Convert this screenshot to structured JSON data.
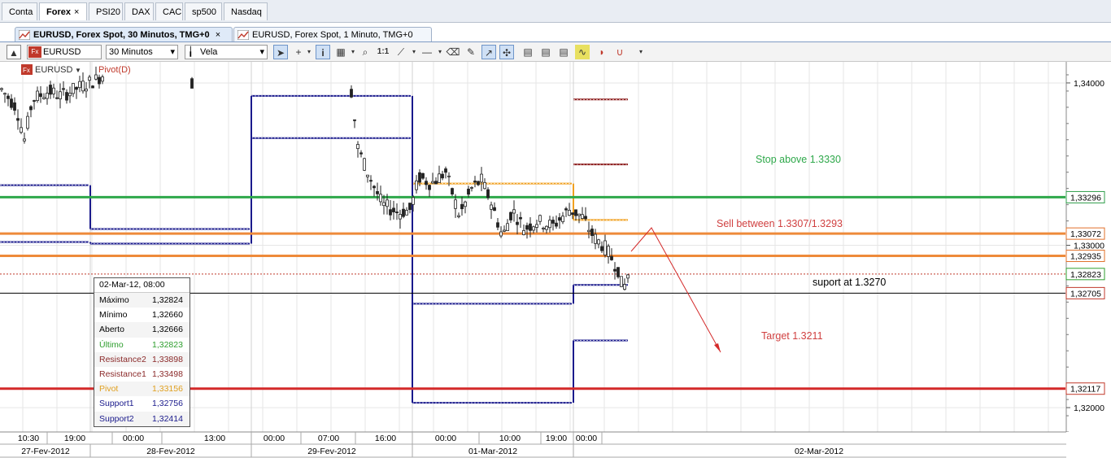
{
  "tabs": [
    {
      "label": "Conta",
      "active": false
    },
    {
      "label": "Forex",
      "active": true,
      "close": "×"
    },
    {
      "label": "PSI20",
      "active": false
    },
    {
      "label": "DAX",
      "active": false
    },
    {
      "label": "CAC",
      "active": false
    },
    {
      "label": "sp500",
      "active": false
    },
    {
      "label": "Nasdaq",
      "active": false
    }
  ],
  "subtabs": [
    {
      "label": "EURUSD, Forex Spot, 30 Minutos, TMG+0",
      "active": true,
      "close": "×"
    },
    {
      "label": "EURUSD, Forex Spot, 1 Minuto, TMG+0",
      "active": false
    }
  ],
  "toolbar": {
    "symbol": "EURUSD",
    "interval": "30 Minutos",
    "chart_type": "Vela",
    "zoom_label": "1:1"
  },
  "overlay": {
    "symbol": "EURUSD",
    "indicator": "Pivot(D)"
  },
  "info_box": {
    "header": "02-Mar-12, 08:00",
    "rows": [
      {
        "label": "Máximo",
        "value": "1,32824",
        "color": "#000000"
      },
      {
        "label": "Mínimo",
        "value": "1,32660",
        "color": "#000000"
      },
      {
        "label": "Aberto",
        "value": "1,32666",
        "color": "#000000"
      },
      {
        "label": "Último",
        "value": "1,32823",
        "color": "#2e9e2e"
      },
      {
        "label": "Resistance2",
        "value": "1,33898",
        "color": "#8b2a2a"
      },
      {
        "label": "Resistance1",
        "value": "1,33498",
        "color": "#8b2a2a"
      },
      {
        "label": "Pivot",
        "value": "1,33156",
        "color": "#e0a020"
      },
      {
        "label": "Support1",
        "value": "1,32756",
        "color": "#1a1a8c"
      },
      {
        "label": "Support2",
        "value": "1,32414",
        "color": "#1a1a8c"
      }
    ]
  },
  "chart_data": {
    "type": "candlestick",
    "symbol": "EURUSD",
    "interval": "30 Minutos",
    "ylim": [
      1.3185,
      1.3413
    ],
    "y_ticks": [
      {
        "value": 1.34,
        "label": "1,34000"
      },
      {
        "value": 1.33,
        "label": "1,33000"
      },
      {
        "value": 1.32,
        "label": "1,32000"
      }
    ],
    "x_time_labels": [
      "10:30",
      "19:00",
      "00:00",
      "13:00",
      "00:00",
      "07:00",
      "16:00",
      "00:00",
      "10:00",
      "19:00",
      "00:00"
    ],
    "x_date_labels": [
      "27-Fev-2012",
      "28-Fev-2012",
      "29-Fev-2012",
      "01-Mar-2012",
      "02-Mar-2012"
    ],
    "price_labels": [
      {
        "value": 1.33296,
        "label": "1,33296",
        "color": "#2e9e4a"
      },
      {
        "value": 1.33072,
        "label": "1,33072",
        "color": "#e0712a"
      },
      {
        "value": 1.32935,
        "label": "1,32935",
        "color": "#e0712a"
      },
      {
        "value": 1.32823,
        "label": "1,32823",
        "color": "#2e9e2e"
      },
      {
        "value": 1.32705,
        "label": "1,32705",
        "color": "#c0392b"
      },
      {
        "value": 1.32117,
        "label": "1,32117",
        "color": "#c0392b"
      }
    ],
    "horizontal_lines": [
      {
        "name": "stop",
        "value": 1.33296,
        "color": "#2ea84a"
      },
      {
        "name": "sell-high",
        "value": 1.33072,
        "color": "#ee8a3a"
      },
      {
        "name": "sell-low",
        "value": 1.32935,
        "color": "#ee8a3a"
      },
      {
        "name": "support",
        "value": 1.32705,
        "color": "#000000"
      },
      {
        "name": "target",
        "value": 1.32117,
        "color": "#d42a2a"
      },
      {
        "name": "last",
        "value": 1.32823,
        "color": "#c0392b"
      }
    ],
    "annotations": [
      {
        "text": "Stop above 1.3330",
        "color": "#2ea84a"
      },
      {
        "text": "Sell between 1.3307/1.3293",
        "color": "#d04040"
      },
      {
        "text": "suport at 1.3270",
        "color": "#000000"
      },
      {
        "text": "Target 1.3211",
        "color": "#d04040"
      }
    ],
    "pivot_series": [
      {
        "name": "Resistance2",
        "color": "#8b1a1a",
        "segments": [
          [
            null,
            null
          ],
          [
            null,
            null
          ],
          [
            null,
            null
          ],
          [
            null,
            null
          ],
          [
            1.33898,
            1.33898
          ]
        ]
      },
      {
        "name": "Resistance1",
        "color": "#8b1a1a",
        "segments": [
          [
            null,
            null
          ],
          [
            null,
            null
          ],
          [
            null,
            null
          ],
          [
            null,
            null
          ],
          [
            1.33498,
            1.33498
          ]
        ]
      },
      {
        "name": "Pivot",
        "color": "#f0a020",
        "segments": [
          [
            null,
            null
          ],
          [
            null,
            null
          ],
          [
            null,
            null
          ],
          [
            1.3338,
            1.3338
          ],
          [
            1.33156,
            1.33156
          ]
        ]
      },
      {
        "name": "Support1",
        "color": "#1a1a8c",
        "segments": [
          [
            1.3337,
            1.3337
          ],
          [
            1.331,
            1.331
          ],
          [
            1.3366,
            1.3366
          ],
          [
            1.3264,
            1.3264
          ],
          [
            1.32756,
            1.32756
          ]
        ]
      },
      {
        "name": "Support2",
        "color": "#1a1a8c",
        "segments": [
          [
            1.3302,
            1.3302
          ],
          [
            1.3301,
            1.3301
          ],
          [
            1.3392,
            1.3392
          ],
          [
            1.3203,
            1.3203
          ],
          [
            1.32414,
            1.32414
          ]
        ]
      }
    ]
  }
}
